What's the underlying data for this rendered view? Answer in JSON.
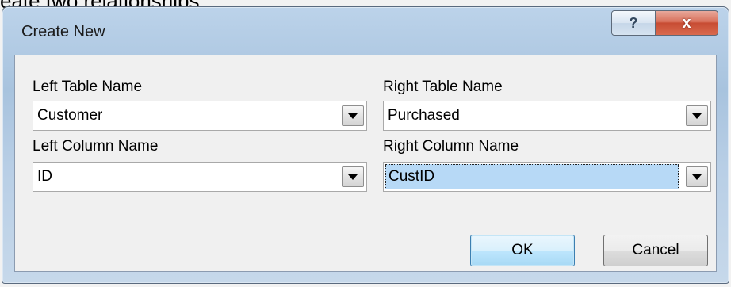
{
  "background": {
    "text": "eate two relationships"
  },
  "dialog": {
    "title": "Create New",
    "help_label": "?",
    "close_label": "x"
  },
  "form": {
    "left_table": {
      "label": "Left Table Name",
      "value": "Customer"
    },
    "right_table": {
      "label": "Right Table Name",
      "value": "Purchased"
    },
    "left_column": {
      "label": "Left Column Name",
      "value": "ID"
    },
    "right_column": {
      "label": "Right Column Name",
      "value": "CustID",
      "selected": true
    }
  },
  "buttons": {
    "ok": "OK",
    "cancel": "Cancel"
  }
}
